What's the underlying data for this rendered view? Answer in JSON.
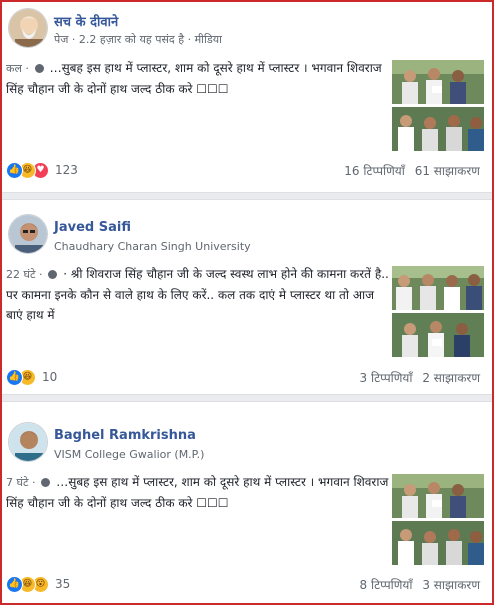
{
  "posts": [
    {
      "author": "सच के दीवाने",
      "subline": "पेज · 2.2 हज़ार को यह पसंद है · मीडिया",
      "time": "कल ·",
      "text": "…सुबह इस हाथ में प्लास्टर, शाम को दूसरे हाथ में प्लास्टर । भगवान शिवराज सिंह चौहान जी के दोनों हाथ जल्द ठीक करे ☐☐☐",
      "reaction_icons": [
        "like-icon",
        "haha-icon",
        "love-icon"
      ],
      "reaction_count": "123",
      "comments": "16 टिप्पणियाँ",
      "shares": "61 साझाकरण"
    },
    {
      "author": "Javed Saifi",
      "subline": "Chaudhary Charan Singh University",
      "time": "22 घंटे ·",
      "text": "· श्री शिवराज सिंह चौहान जी के जल्द स्वस्थ लाभ होने की कामना करतें है.. पर कामना इनके कौन से वाले हाथ के लिए करें.. कल तक दाएं मे प्लास्टर था तो आज बाएं हाथ में",
      "reaction_icons": [
        "like-icon",
        "haha-icon"
      ],
      "reaction_count": "10",
      "comments": "3 टिप्पणियाँ",
      "shares": "2 साझाकरण"
    },
    {
      "author": "Baghel Ramkrishna",
      "subline": "VISM College Gwalior (M.P.)",
      "time": "7 घंटे ·",
      "text": "…सुबह इस हाथ में प्लास्टर, शाम को दूसरे हाथ में प्लास्टर । भगवान शिवराज सिंह चौहान जी के दोनों हाथ जल्द ठीक करे ☐☐☐",
      "reaction_icons": [
        "like-icon",
        "haha-icon",
        "wow-icon"
      ],
      "reaction_count": "35",
      "comments": "8 टिप्पणियाँ",
      "shares": "3 साझाकरण"
    }
  ],
  "colors": {
    "author_link": "#365899",
    "meta_text": "#606770",
    "like_blue": "#1877f2",
    "love_red": "#f33e58",
    "haha_yellow": "#f7b928",
    "frame_border": "#cc2a2a"
  }
}
